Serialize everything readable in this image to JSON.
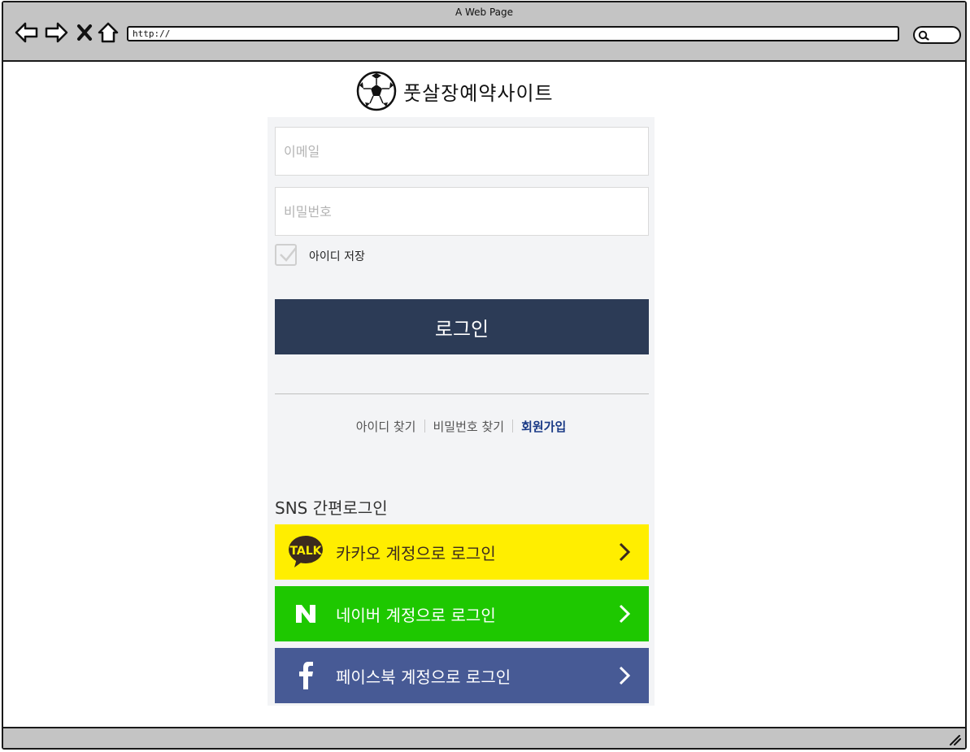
{
  "window": {
    "title": "A Web Page",
    "url": "http://"
  },
  "logo": {
    "text": "풋살장예약사이트"
  },
  "form": {
    "email_placeholder": "이메일",
    "password_placeholder": "비밀번호",
    "remember_label": "아이디 저장",
    "login_label": "로그인"
  },
  "links": {
    "find_id": "아이디 찾기",
    "find_password": "비밀번호 찾기",
    "signup": "회원가입"
  },
  "sns": {
    "title": "SNS 간편로그인",
    "kakao": {
      "label": "카카오 계정으로 로그인",
      "icon": "kakao-talk-icon",
      "badge": "TALK",
      "color": "#ffee00"
    },
    "naver": {
      "label": "네이버 계정으로 로그인",
      "icon": "naver-n-icon",
      "color": "#1ec800"
    },
    "facebook": {
      "label": "페이스북 계정으로 로그인",
      "icon": "facebook-f-icon",
      "color": "#475a95"
    }
  },
  "colors": {
    "login_button": "#2c3b56",
    "panel_bg": "#f3f4f6",
    "signup_link": "#1a3a86"
  }
}
